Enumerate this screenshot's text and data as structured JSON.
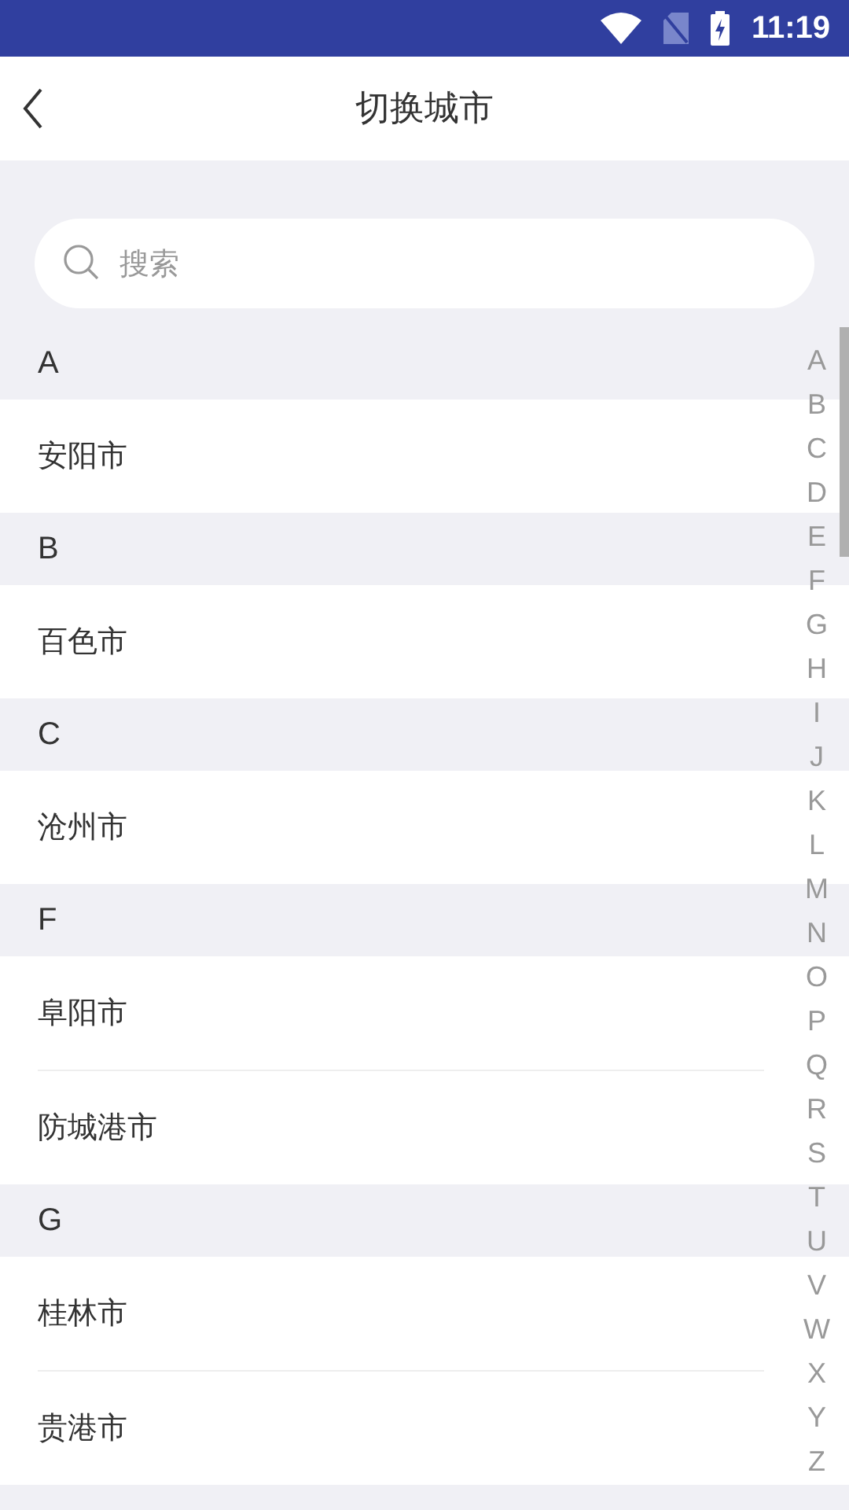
{
  "status_bar": {
    "time": "11:19"
  },
  "header": {
    "title": "切换城市"
  },
  "search": {
    "placeholder": "搜索"
  },
  "sections": [
    {
      "letter": "A",
      "cities": [
        "安阳市"
      ]
    },
    {
      "letter": "B",
      "cities": [
        "百色市"
      ]
    },
    {
      "letter": "C",
      "cities": [
        "沧州市"
      ]
    },
    {
      "letter": "F",
      "cities": [
        "阜阳市",
        "防城港市"
      ]
    },
    {
      "letter": "G",
      "cities": [
        "桂林市",
        "贵港市"
      ]
    }
  ],
  "index_bar": [
    "A",
    "B",
    "C",
    "D",
    "E",
    "F",
    "G",
    "H",
    "I",
    "J",
    "K",
    "L",
    "M",
    "N",
    "O",
    "P",
    "Q",
    "R",
    "S",
    "T",
    "U",
    "V",
    "W",
    "X",
    "Y",
    "Z"
  ]
}
